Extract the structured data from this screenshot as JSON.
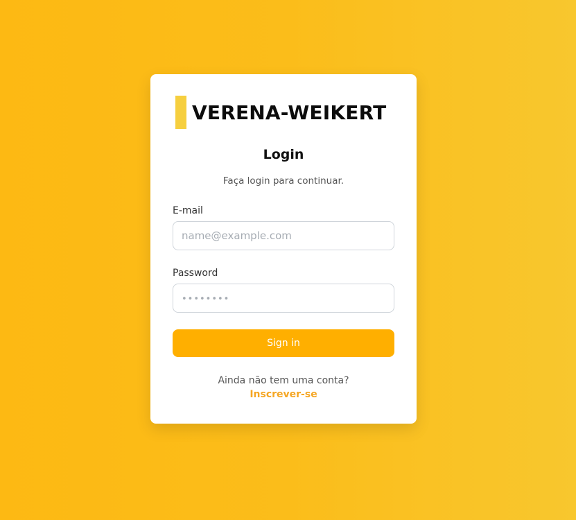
{
  "brand": {
    "name": "VERENA-WEIKERT"
  },
  "login": {
    "title": "Login",
    "subtitle": "Faça login para continuar.",
    "email_label": "E-mail",
    "email_placeholder": "name@example.com",
    "password_label": "Password",
    "password_placeholder": "••••••••",
    "submit_label": "Sign in",
    "no_account_text": "Ainda não tem uma conta?",
    "signup_label": "Inscrever-se"
  },
  "colors": {
    "background": "#fdb913",
    "accent": "#ffaf00",
    "brand_bar": "#f6cf3f",
    "signup_link": "#f5a623"
  }
}
